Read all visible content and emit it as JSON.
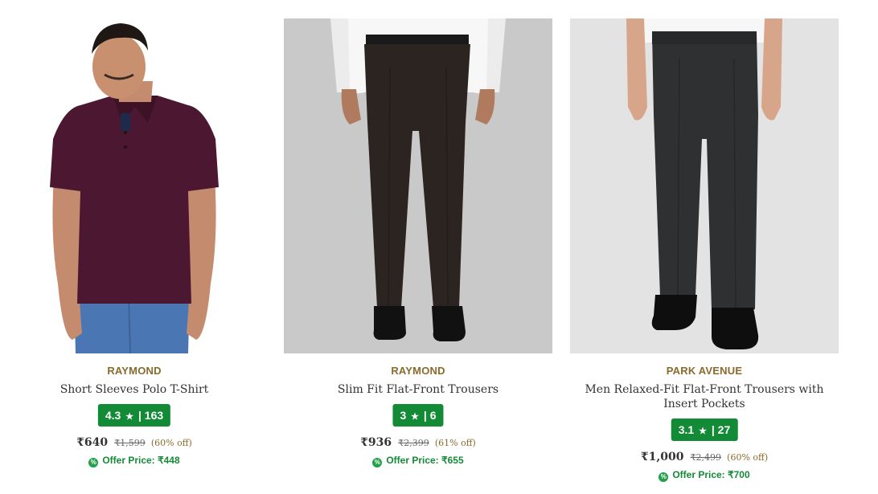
{
  "products": [
    {
      "brand": "RAYMOND",
      "title": "Short Sleeves Polo T-Shirt",
      "rating": "4.3",
      "reviews": "163",
      "price": "₹640",
      "mrp": "₹1,599",
      "discount": "(60% off)",
      "offer_price": "Offer Price: ₹448"
    },
    {
      "brand": "RAYMOND",
      "title": "Slim Fit Flat-Front Trousers",
      "rating": "3",
      "reviews": "6",
      "price": "₹936",
      "mrp": "₹2,399",
      "discount": "(61% off)",
      "offer_price": "Offer Price: ₹655"
    },
    {
      "brand": "PARK AVENUE",
      "title": "Men Relaxed-Fit Flat-Front Trousers with Insert Pockets",
      "rating": "3.1",
      "reviews": "27",
      "price": "₹1,000",
      "mrp": "₹2,499",
      "discount": "(60% off)",
      "offer_price": "Offer Price: ₹700"
    }
  ],
  "icons": {
    "star": "star-icon",
    "offer": "discount-badge-icon"
  },
  "colors": {
    "brand_text": "#8a6a2c",
    "rating_bg": "#138a36",
    "offer_text": "#138a36"
  }
}
